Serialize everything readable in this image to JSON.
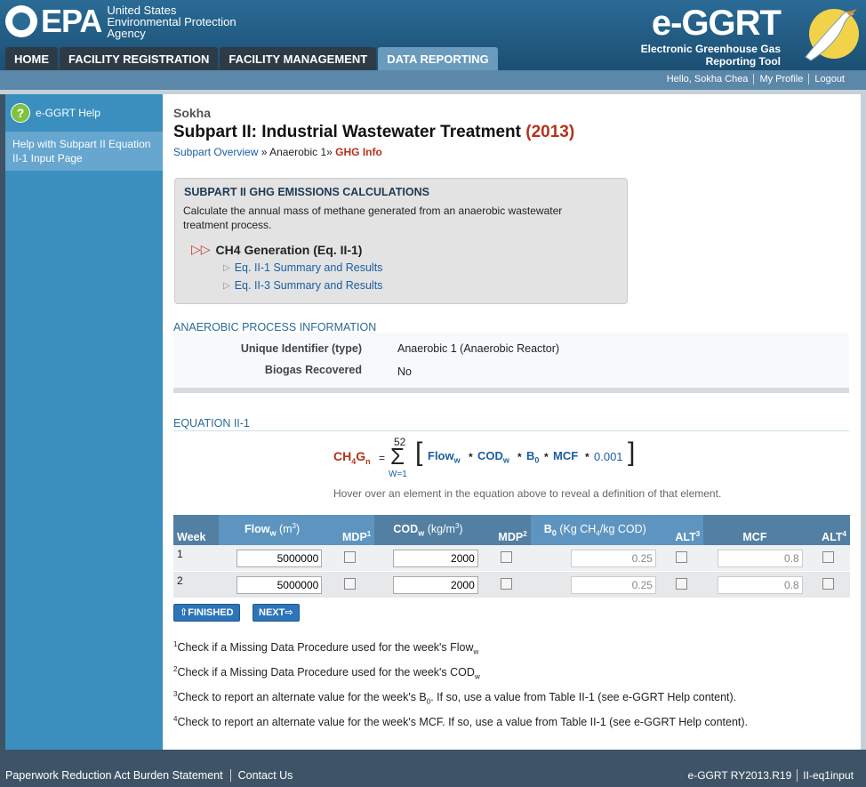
{
  "header": {
    "epa_word": "EPA",
    "agency_line1": "United States",
    "agency_line2": "Environmental Protection",
    "agency_line3": "Agency",
    "app_title": "e-GGRT",
    "app_sub1": "Electronic Greenhouse Gas",
    "app_sub2": "Reporting Tool"
  },
  "nav": {
    "tabs": [
      {
        "label": "HOME"
      },
      {
        "label": "FACILITY REGISTRATION"
      },
      {
        "label": "FACILITY MANAGEMENT"
      },
      {
        "label": "DATA REPORTING"
      }
    ]
  },
  "userbar": {
    "greeting": "Hello, Sokha Chea",
    "profile": "My Profile",
    "logout": "Logout"
  },
  "sidebar": {
    "help_label": "e-GGRT Help",
    "help_link": "Help with Subpart II Equation II-1 Input Page"
  },
  "main": {
    "facility": "Sokha",
    "title": "Subpart II: Industrial Wastewater Treatment",
    "year": "(2013)",
    "crumb_overview": "Subpart Overview",
    "crumb_sep1": "»",
    "crumb_unit": "Anaerobic 1",
    "crumb_sep2": "»",
    "crumb_current": "GHG Info"
  },
  "calc_box": {
    "title": "SUBPART II GHG EMISSIONS CALCULATIONS",
    "desc": "Calculate the annual mass of methane generated from an anaerobic wastewater treatment process.",
    "ch4_heading": "CH4 Generation (Eq. II-1)",
    "link1": "Eq. II-1 Summary and Results",
    "link2": "Eq. II-3 Summary and Results"
  },
  "process": {
    "heading": "ANAEROBIC PROCESS INFORMATION",
    "uid_label": "Unique Identifier (type)",
    "uid_value": "Anaerobic 1 (Anaerobic Reactor)",
    "biogas_label": "Biogas Recovered",
    "biogas_value": "No"
  },
  "equation": {
    "heading": "EQUATION II-1",
    "lhs_ch": "CH",
    "lhs_4": "4",
    "lhs_g": "G",
    "lhs_n": "n",
    "eq": "=",
    "sum_top": "52",
    "sum_bottom": "W=1",
    "flow": "Flow",
    "w1": "w",
    "times": "*",
    "cod": "COD",
    "w2": "w",
    "b": "B",
    "b0": "0",
    "mcf": "MCF",
    "const": "0.001",
    "hint": "Hover over an element in the equation above to reveal a definition of that element."
  },
  "table": {
    "headers": {
      "week": "Week",
      "flow": "Flow",
      "flow_sub": "w",
      "flow_unit": "(m",
      "flow_unit_sup": "3",
      "flow_unit_end": ")",
      "mdp1": "MDP",
      "mdp1_sup": "1",
      "cod": "COD",
      "cod_sub": "w",
      "cod_unit": "(kg/m",
      "cod_unit_sup": "3",
      "cod_unit_end": ")",
      "mdp2": "MDP",
      "mdp2_sup": "2",
      "b0": "B",
      "b0_sub": "0",
      "b0_unit": "(Kg CH",
      "b0_unit_sub": "4",
      "b0_unit_end": "/kg COD)",
      "alt3": "ALT",
      "alt3_sup": "3",
      "mcf": "MCF",
      "alt4": "ALT",
      "alt4_sup": "4"
    },
    "rows": [
      {
        "week": "1",
        "flow": "5000000",
        "cod": "2000",
        "b0": "0.25",
        "mcf": "0.8"
      },
      {
        "week": "2",
        "flow": "5000000",
        "cod": "2000",
        "b0": "0.25",
        "mcf": "0.8"
      }
    ]
  },
  "buttons": {
    "finished": "FINISHED",
    "next": "NEXT"
  },
  "footnotes": {
    "n1_sup": "1",
    "n1": "Check if a Missing Data Procedure used for the week's Flow",
    "n1_sub": "w",
    "n2_sup": "2",
    "n2": "Check if a Missing Data Procedure used for the week's COD",
    "n2_sub": "w",
    "n3_sup": "3",
    "n3a": "Check to report an alternate value for the week's B",
    "n3_sub": "0",
    "n3b": ". If so, use a value from Table II-1 (see e-GGRT Help content).",
    "n4_sup": "4",
    "n4": "Check to report an alternate value for the week's MCF. If so, use a value from Table II-1 (see e-GGRT Help content)."
  },
  "footer": {
    "paperwork": "Paperwork Reduction Act Burden Statement",
    "contact": "Contact Us",
    "version": "e-GGRT RY2013.R19",
    "page_id": "II-eq1input"
  },
  "colors": {
    "brand_blue": "#2a6b96",
    "accent_red": "#b5321c",
    "link_blue": "#1a5fa3",
    "table_header": "#5e95c0"
  }
}
